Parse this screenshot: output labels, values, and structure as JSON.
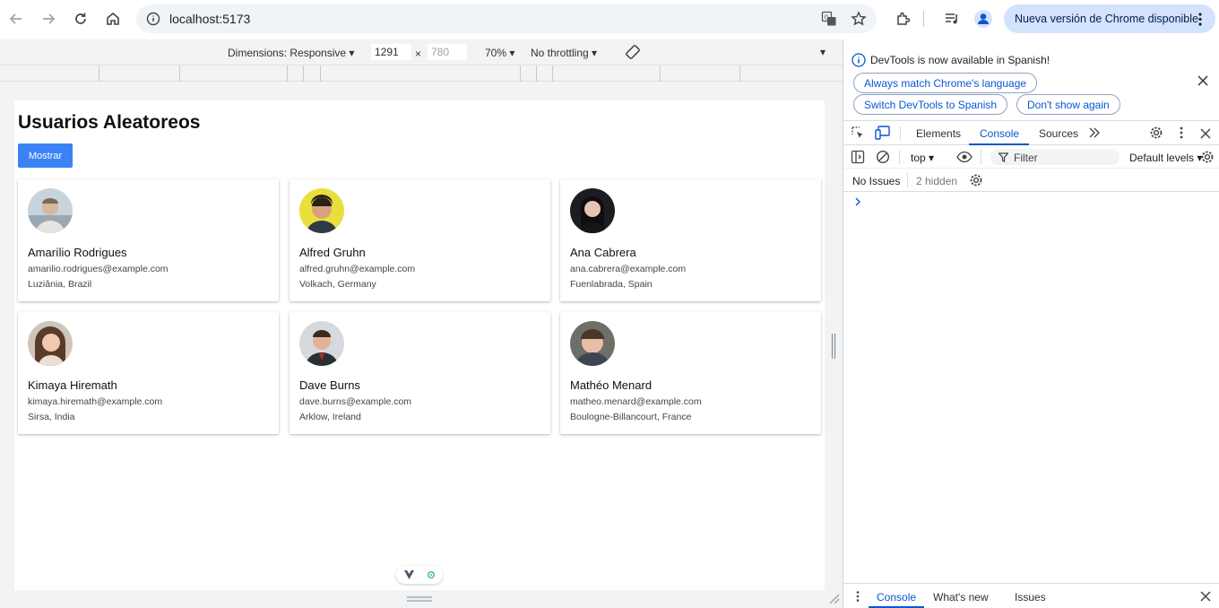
{
  "browser": {
    "url": "localhost:5173",
    "update_label": "Nueva versión de Chrome disponible"
  },
  "device_toolbar": {
    "dimensions_label": "Dimensions: Responsive",
    "width": "1291",
    "times": "×",
    "height": "780",
    "zoom": "70%",
    "throttling": "No throttling"
  },
  "page": {
    "title": "Usuarios Aleatoreos",
    "show_button": "Mostrar",
    "users": [
      {
        "name": "Amarílio Rodrigues",
        "email": "amarilio.rodrigues@example.com",
        "location": "Luziânia, Brazil"
      },
      {
        "name": "Alfred Gruhn",
        "email": "alfred.gruhn@example.com",
        "location": "Volkach, Germany"
      },
      {
        "name": "Ana Cabrera",
        "email": "ana.cabrera@example.com",
        "location": "Fuenlabrada, Spain"
      },
      {
        "name": "Kimaya Hiremath",
        "email": "kimaya.hiremath@example.com",
        "location": "Sirsa, India"
      },
      {
        "name": "Dave Burns",
        "email": "dave.burns@example.com",
        "location": "Arklow, Ireland"
      },
      {
        "name": "Mathéo Menard",
        "email": "matheo.menard@example.com",
        "location": "Boulogne-Billancourt, France"
      }
    ]
  },
  "devtools": {
    "notice": "DevTools is now available in Spanish!",
    "btn_match": "Always match Chrome's language",
    "btn_switch": "Switch DevTools to Spanish",
    "btn_dont_show": "Don't show again",
    "tabs": [
      "Elements",
      "Console",
      "Sources"
    ],
    "context": "top",
    "filter_placeholder": "Filter",
    "levels": "Default levels",
    "no_issues": "No Issues",
    "hidden": "2 hidden",
    "drawer_tabs": [
      "Console",
      "What's new",
      "Issues"
    ]
  },
  "colors": {
    "accent": "#3b82f6",
    "devtools_blue": "#0b57d0"
  }
}
